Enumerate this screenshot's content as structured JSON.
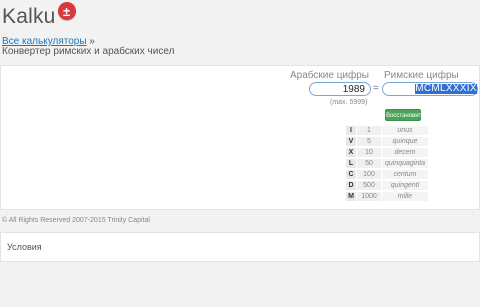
{
  "header": {
    "logo_text": "Kalku",
    "logo_badge": "±"
  },
  "breadcrumb": {
    "link": "Все калькуляторы",
    "separator": " »"
  },
  "subtitle": "Конвертер римских и арабских чисел",
  "converter": {
    "arabic_label": "Арабские цифры",
    "roman_label": "Римские цифры",
    "arabic_value": "1989",
    "equals": "=",
    "roman_value": "MCMLXXXIX",
    "max_hint": "(max. 5999)",
    "restore_button": "Восстановить"
  },
  "roman_table": [
    {
      "symbol": "I",
      "value": "1",
      "name": "unus"
    },
    {
      "symbol": "V",
      "value": "5",
      "name": "quinque"
    },
    {
      "symbol": "X",
      "value": "10",
      "name": "decem"
    },
    {
      "symbol": "L",
      "value": "50",
      "name": "quinquaginta"
    },
    {
      "symbol": "C",
      "value": "100",
      "name": "centum"
    },
    {
      "symbol": "D",
      "value": "500",
      "name": "quingenti"
    },
    {
      "symbol": "M",
      "value": "1000",
      "name": "mille"
    }
  ],
  "footer": {
    "copyright": "© All Rights Reserved 2007-2015 Trinity Capital",
    "terms_link": "Условия"
  },
  "colors": {
    "link": "#1a78c2",
    "badge": "#d73a3a",
    "button": "#4aa55a",
    "selection": "#2f6fd6"
  }
}
